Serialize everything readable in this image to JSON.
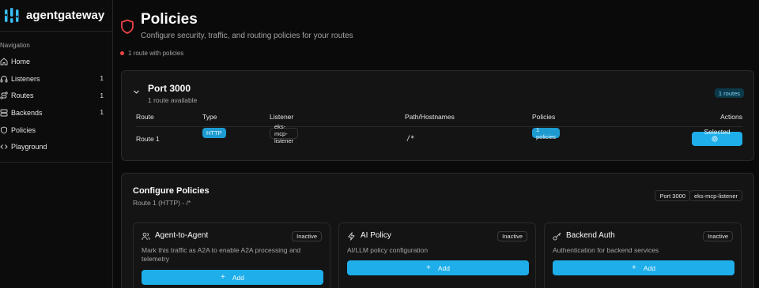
{
  "app": {
    "name": "agentgateway"
  },
  "sidebar": {
    "section_label": "Navigation",
    "items": [
      {
        "label": "Home",
        "icon": "home-icon",
        "count": ""
      },
      {
        "label": "Listeners",
        "icon": "headphones-icon",
        "count": "1"
      },
      {
        "label": "Routes",
        "icon": "route-icon",
        "count": "1"
      },
      {
        "label": "Backends",
        "icon": "server-icon",
        "count": "1"
      },
      {
        "label": "Policies",
        "icon": "shield-icon",
        "count": ""
      },
      {
        "label": "Playground",
        "icon": "code-icon",
        "count": ""
      }
    ]
  },
  "header": {
    "title": "Policies",
    "subtitle": "Configure security, traffic, and routing policies for your routes",
    "status": "1 route with policies"
  },
  "port_card": {
    "title": "Port 3000",
    "subtitle": "1 route available",
    "routes_badge": "1 routes",
    "columns": [
      "Route",
      "Type",
      "Listener",
      "Path/Hostnames",
      "Policies",
      "Actions"
    ],
    "rows": [
      {
        "route": "Route 1",
        "type": "HTTP",
        "listener": "eks-mcp-listener",
        "path": "/*",
        "policies": "1 policies",
        "action": "Selected"
      }
    ]
  },
  "config": {
    "title": "Configure Policies",
    "subtitle": "Route 1 (HTTP) - /*",
    "tags": [
      "Port 3000",
      "eks-mcp-listener"
    ],
    "policies": [
      {
        "title": "Agent-to-Agent",
        "icon": "users-icon",
        "status": "Inactive",
        "description": "Mark this traffic as A2A to enable A2A processing and telemetry",
        "button": "Add"
      },
      {
        "title": "AI Policy",
        "icon": "zap-icon",
        "status": "Inactive",
        "description": "AI/LLM policy configuration",
        "button": "Add"
      },
      {
        "title": "Backend Auth",
        "icon": "key-icon",
        "status": "Inactive",
        "description": "Authentication for backend services",
        "button": "Add"
      }
    ]
  },
  "colors": {
    "accent": "#1eaee9",
    "status_dot": "#ef4444",
    "shield": "#ef4444"
  }
}
